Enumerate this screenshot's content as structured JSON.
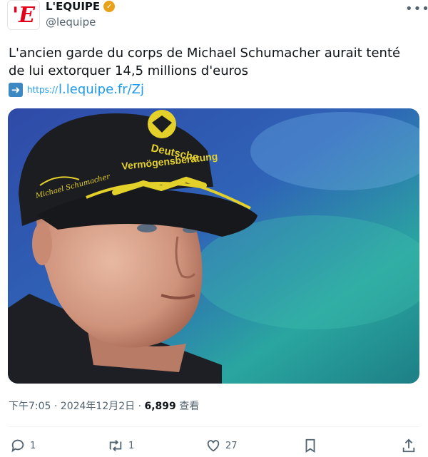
{
  "account": {
    "logo_text": "'E",
    "name": "L'EQUIPE",
    "handle": "@lequipe"
  },
  "tweet": {
    "text": "L'ancien garde du corps de Michael Schumacher aurait tenté de lui extorquer 14,5 millions d'euros",
    "link_prefix": "https://",
    "link_main": "l.lequipe.fr/Zj"
  },
  "photo": {
    "cap_text_1": "Deutsche",
    "cap_text_2": "Vermögensberatung",
    "cap_signature": "Michael Schumacher"
  },
  "meta": {
    "time_date": "下午7:05 · 2024年12月2日 · ",
    "views": "6,899",
    "views_label": " 查看"
  },
  "actions": {
    "replies": "1",
    "reposts": "1",
    "likes": "27"
  },
  "colors": {
    "accent": "#1d9bf0",
    "brand": "#e2001a",
    "badge": "#e8a21a"
  }
}
